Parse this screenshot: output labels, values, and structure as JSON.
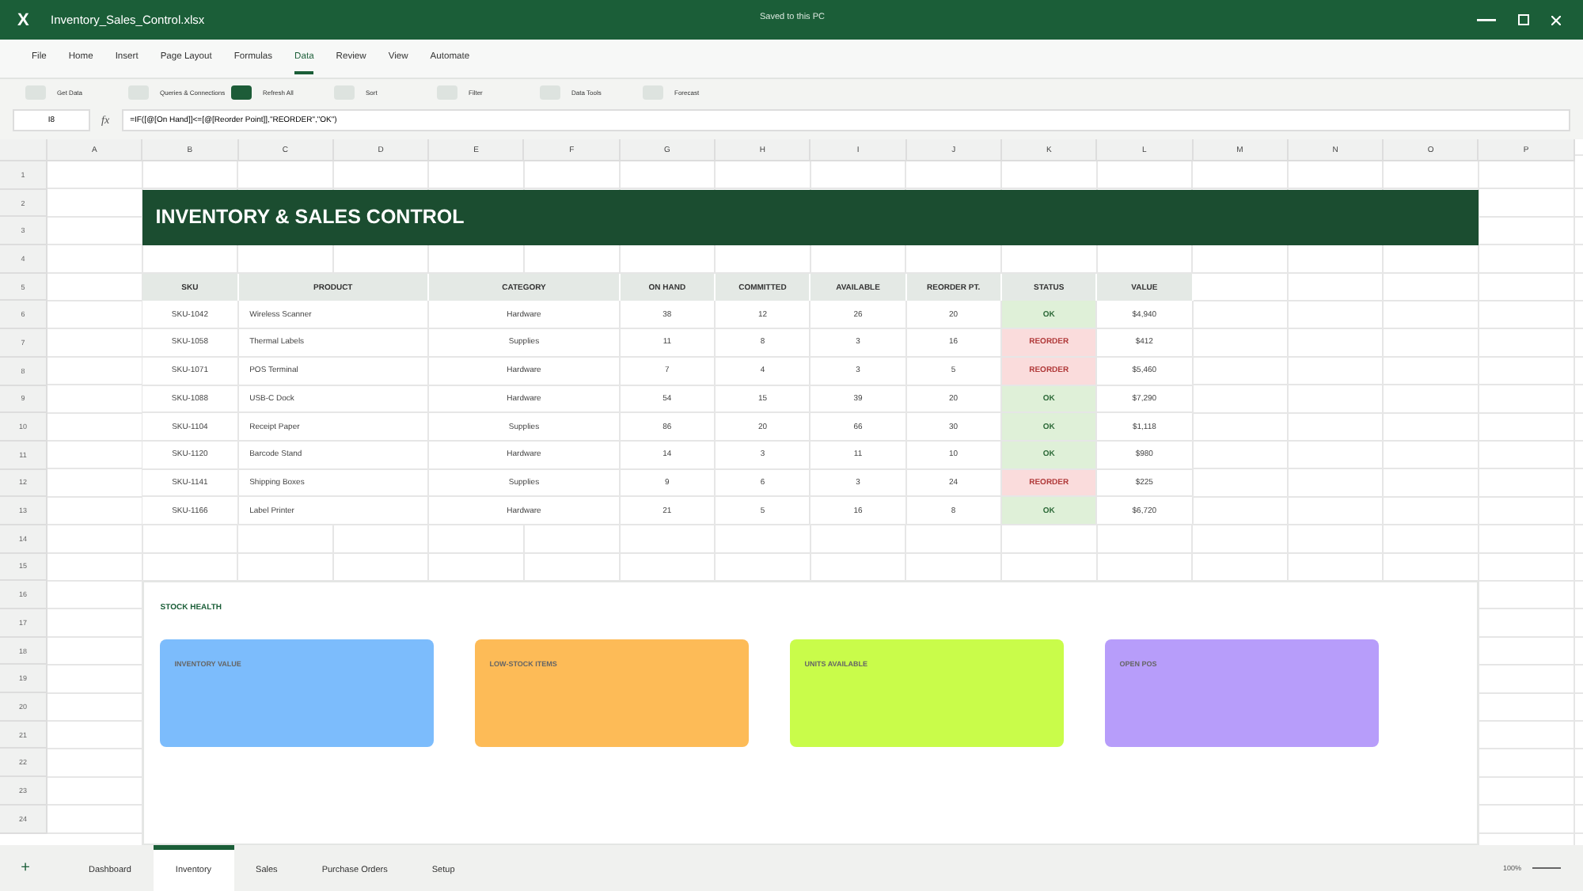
{
  "window": {
    "app_letter": "X",
    "title": "Inventory_Sales_Control.xlsx",
    "save_status": "Saved to this PC"
  },
  "menu": [
    {
      "label": "File",
      "selected": false
    },
    {
      "label": "Home",
      "selected": false
    },
    {
      "label": "Insert",
      "selected": false
    },
    {
      "label": "Page Layout",
      "selected": false
    },
    {
      "label": "Formulas",
      "selected": false
    },
    {
      "label": "Data",
      "selected": true
    },
    {
      "label": "Review",
      "selected": false
    },
    {
      "label": "View",
      "selected": false
    },
    {
      "label": "Automate",
      "selected": false
    }
  ],
  "ribbon": [
    {
      "label": "Get Data",
      "selected": false
    },
    {
      "label": "Queries & Connections",
      "selected": false
    },
    {
      "label": "Refresh All",
      "selected": true
    },
    {
      "label": "Sort",
      "selected": false
    },
    {
      "label": "Filter",
      "selected": false
    },
    {
      "label": "Data Tools",
      "selected": false
    },
    {
      "label": "Forecast",
      "selected": false
    }
  ],
  "formula_bar": {
    "name_box": "I8",
    "fx": "fx",
    "formula": "=IF([@[On Hand]]<=[@[Reorder Point]],\"REORDER\",\"OK\")"
  },
  "columns": [
    "A",
    "B",
    "C",
    "D",
    "E",
    "F",
    "G",
    "H",
    "I",
    "J",
    "K",
    "L",
    "M",
    "N",
    "O",
    "P"
  ],
  "row_numbers": [
    "1",
    "2",
    "3",
    "4",
    "5",
    "6",
    "7",
    "8",
    "9",
    "10",
    "11",
    "12",
    "13",
    "14",
    "15",
    "16",
    "17",
    "18",
    "19",
    "20",
    "21",
    "22",
    "23",
    "24"
  ],
  "banner": {
    "title": "INVENTORY & SALES CONTROL"
  },
  "table": {
    "columns": [
      "SKU",
      "PRODUCT",
      "CATEGORY",
      "ON HAND",
      "COMMITTED",
      "AVAILABLE",
      "REORDER PT.",
      "STATUS",
      "VALUE"
    ],
    "rows": [
      {
        "sku": "SKU-1042",
        "product": "Wireless Scanner",
        "category": "Hardware",
        "on_hand": "38",
        "committed": "12",
        "available": "26",
        "reorder_pt": "20",
        "status": {
          "text": "OK",
          "kind": "ok"
        },
        "value": "$4,940"
      },
      {
        "sku": "SKU-1058",
        "product": "Thermal Labels",
        "category": "Supplies",
        "on_hand": "11",
        "committed": "8",
        "available": "3",
        "reorder_pt": "16",
        "status": {
          "text": "REORDER",
          "kind": "reorder"
        },
        "value": "$412"
      },
      {
        "sku": "SKU-1071",
        "product": "POS Terminal",
        "category": "Hardware",
        "on_hand": "7",
        "committed": "4",
        "available": "3",
        "reorder_pt": "5",
        "status": {
          "text": "REORDER",
          "kind": "reorder"
        },
        "value": "$5,460"
      },
      {
        "sku": "SKU-1088",
        "product": "USB-C Dock",
        "category": "Hardware",
        "on_hand": "54",
        "committed": "15",
        "available": "39",
        "reorder_pt": "20",
        "status": {
          "text": "OK",
          "kind": "ok"
        },
        "value": "$7,290"
      },
      {
        "sku": "SKU-1104",
        "product": "Receipt Paper",
        "category": "Supplies",
        "on_hand": "86",
        "committed": "20",
        "available": "66",
        "reorder_pt": "30",
        "status": {
          "text": "OK",
          "kind": "ok"
        },
        "value": "$1,118"
      },
      {
        "sku": "SKU-1120",
        "product": "Barcode Stand",
        "category": "Hardware",
        "on_hand": "14",
        "committed": "3",
        "available": "11",
        "reorder_pt": "10",
        "status": {
          "text": "OK",
          "kind": "ok"
        },
        "value": "$980"
      },
      {
        "sku": "SKU-1141",
        "product": "Shipping Boxes",
        "category": "Supplies",
        "on_hand": "9",
        "committed": "6",
        "available": "3",
        "reorder_pt": "24",
        "status": {
          "text": "REORDER",
          "kind": "reorder"
        },
        "value": "$225"
      },
      {
        "sku": "SKU-1166",
        "product": "Label Printer",
        "category": "Hardware",
        "on_hand": "21",
        "committed": "5",
        "available": "16",
        "reorder_pt": "8",
        "status": {
          "text": "OK",
          "kind": "ok"
        },
        "value": "$6,720"
      }
    ]
  },
  "stock_health": {
    "title": "STOCK HEALTH",
    "cards": [
      {
        "label": "INVENTORY VALUE",
        "color": "#7cbcfc"
      },
      {
        "label": "LOW-STOCK ITEMS",
        "color": "#fdbb57"
      },
      {
        "label": "UNITS AVAILABLE",
        "color": "#c9fc4a"
      },
      {
        "label": "OPEN POS",
        "color": "#b79dfa"
      }
    ]
  },
  "sheet_tabs": {
    "add": "+",
    "tabs": [
      {
        "label": "Dashboard",
        "selected": false
      },
      {
        "label": "Inventory",
        "selected": true
      },
      {
        "label": "Sales",
        "selected": false
      },
      {
        "label": "Purchase Orders",
        "selected": false
      },
      {
        "label": "Setup",
        "selected": false
      }
    ]
  },
  "zoom": {
    "label": "100%"
  }
}
